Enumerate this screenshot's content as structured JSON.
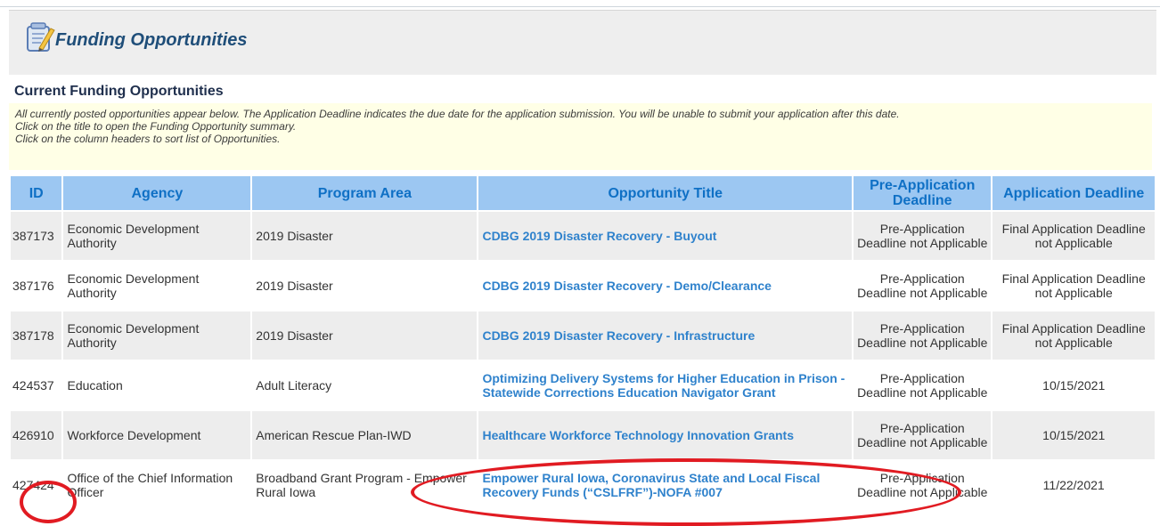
{
  "page": {
    "title": "Funding Opportunities",
    "section_title": "Current Funding Opportunities",
    "notice_lines": [
      "All currently posted opportunities appear below. The Application Deadline indicates the due date for the application submission. You will be unable to submit your application after this date.",
      "Click on the title to open the Funding Opportunity summary.",
      "Click on the column headers to sort list of Opportunities."
    ]
  },
  "table": {
    "headers": {
      "id": "ID",
      "agency": "Agency",
      "program_area": "Program Area",
      "opportunity_title": "Opportunity Title",
      "pre_application_deadline": "Pre-Application Deadline",
      "application_deadline": "Application Deadline"
    },
    "rows": [
      {
        "id": "387173",
        "agency": "Economic Development Authority",
        "program_area": "2019 Disaster",
        "opportunity_title": "CDBG 2019 Disaster Recovery - Buyout",
        "pre_application_deadline": "Pre-Application Deadline not Applicable",
        "application_deadline": "Final Application Deadline not Applicable"
      },
      {
        "id": "387176",
        "agency": "Economic Development Authority",
        "program_area": "2019 Disaster",
        "opportunity_title": "CDBG 2019 Disaster Recovery - Demo/Clearance",
        "pre_application_deadline": "Pre-Application Deadline not Applicable",
        "application_deadline": "Final Application Deadline not Applicable"
      },
      {
        "id": "387178",
        "agency": "Economic Development Authority",
        "program_area": "2019 Disaster",
        "opportunity_title": "CDBG 2019 Disaster Recovery - Infrastructure",
        "pre_application_deadline": "Pre-Application Deadline not Applicable",
        "application_deadline": "Final Application Deadline not Applicable"
      },
      {
        "id": "424537",
        "agency": "Education",
        "program_area": "Adult Literacy",
        "opportunity_title": "Optimizing Delivery Systems for Higher Education in Prison - Statewide Corrections Education Navigator Grant",
        "pre_application_deadline": "Pre-Application Deadline not Applicable",
        "application_deadline": "10/15/2021"
      },
      {
        "id": "426910",
        "agency": "Workforce Development",
        "program_area": "American Rescue Plan-IWD",
        "opportunity_title": "Healthcare Workforce Technology Innovation Grants",
        "pre_application_deadline": "Pre-Application Deadline not Applicable",
        "application_deadline": "10/15/2021"
      },
      {
        "id": "427424",
        "agency": "Office of the Chief Information Officer",
        "program_area": "Broadband Grant Program - Empower Rural Iowa",
        "opportunity_title": "Empower Rural Iowa, Coronavirus State and Local Fiscal Recovery Funds (“CSLFRF”)-NOFA #007",
        "pre_application_deadline": "Pre-Application Deadline not Applicable",
        "application_deadline": "11/22/2021"
      }
    ]
  },
  "icons": {
    "page_icon": "notepad-pencil-icon"
  },
  "colors": {
    "header_bg": "#9cc7f2",
    "header_text": "#0f70c5",
    "link": "#2f82cc",
    "title": "#1f4e79",
    "notice_bg": "#ffffe6",
    "alt_row": "#ededed",
    "annotation": "#e11b22"
  }
}
